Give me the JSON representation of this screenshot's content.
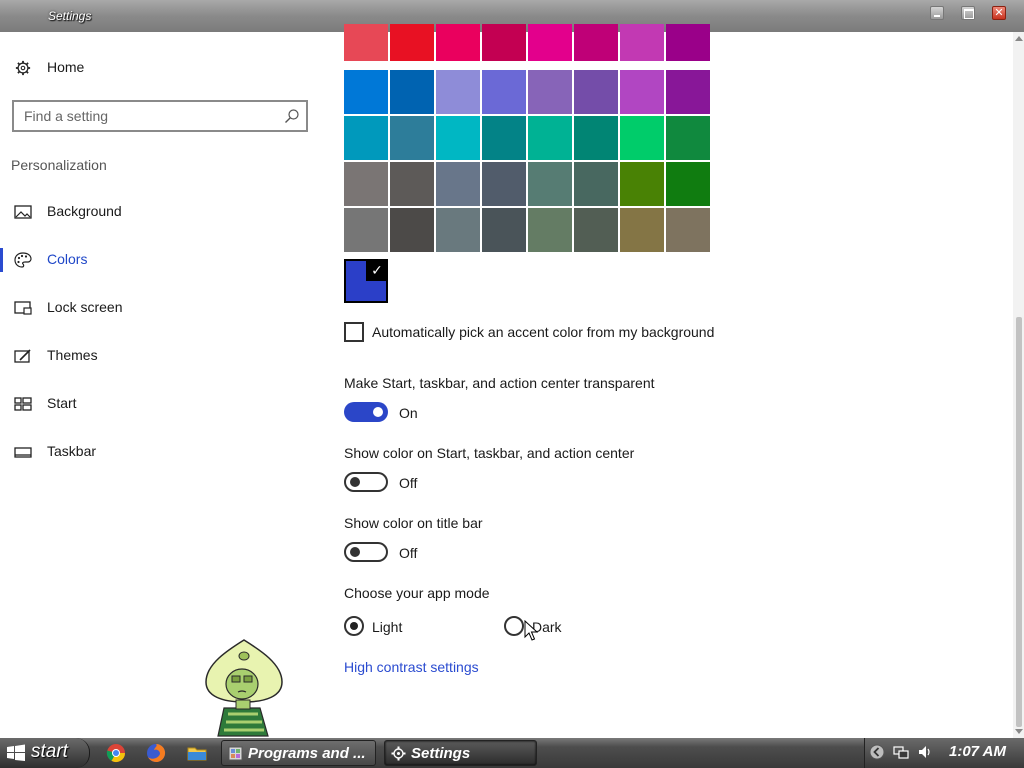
{
  "window": {
    "title": "Settings"
  },
  "nav": {
    "home": "Home",
    "search_placeholder": "Find a setting",
    "section": "Personalization",
    "items": [
      {
        "label": "Background",
        "icon": "picture-icon"
      },
      {
        "label": "Colors",
        "icon": "palette-icon",
        "selected": true
      },
      {
        "label": "Lock screen",
        "icon": "lock-screen-icon"
      },
      {
        "label": "Themes",
        "icon": "themes-icon"
      },
      {
        "label": "Start",
        "icon": "start-icon"
      },
      {
        "label": "Taskbar",
        "icon": "taskbar-icon"
      }
    ]
  },
  "colors": {
    "palette_rows": [
      [
        "#e74856",
        "#e81123",
        "#ea005e",
        "#c30052",
        "#e3008c",
        "#bf0077",
        "#c239b3",
        "#9a0089"
      ],
      [
        "#0078d7",
        "#0063b1",
        "#8e8cd8",
        "#6b69d6",
        "#8764b8",
        "#744da9",
        "#b146c2",
        "#881798"
      ],
      [
        "#0099bc",
        "#2d7d9a",
        "#00b7c3",
        "#038387",
        "#00b294",
        "#018574",
        "#00cc6a",
        "#10893e"
      ],
      [
        "#7a7574",
        "#5d5a58",
        "#68768a",
        "#515c6b",
        "#567c73",
        "#486860",
        "#498205",
        "#107c10"
      ],
      [
        "#767676",
        "#4c4a48",
        "#69797e",
        "#4a5459",
        "#647c64",
        "#525e54",
        "#847545",
        "#7e735f"
      ]
    ],
    "custom_color": "#2b3fc8",
    "auto_pick_label": "Automatically pick an accent color from my background",
    "auto_pick_checked": false,
    "transparent_label": "Make Start, taskbar, and action center transparent",
    "transparent_state": "On",
    "show_color_start_label": "Show color on Start, taskbar, and action center",
    "show_color_start_state": "Off",
    "show_color_title_label": "Show color on title bar",
    "show_color_title_state": "Off",
    "app_mode_label": "Choose your app mode",
    "app_mode_options": [
      "Light",
      "Dark"
    ],
    "app_mode_selected": "Light",
    "high_contrast_link": "High contrast settings"
  },
  "taskbar": {
    "start_label": "start",
    "tasks": [
      {
        "label": "Programs and ...",
        "active": false
      },
      {
        "label": "Settings",
        "active": true
      }
    ],
    "clock": "1:07 AM"
  },
  "accent": "#2b46c8"
}
